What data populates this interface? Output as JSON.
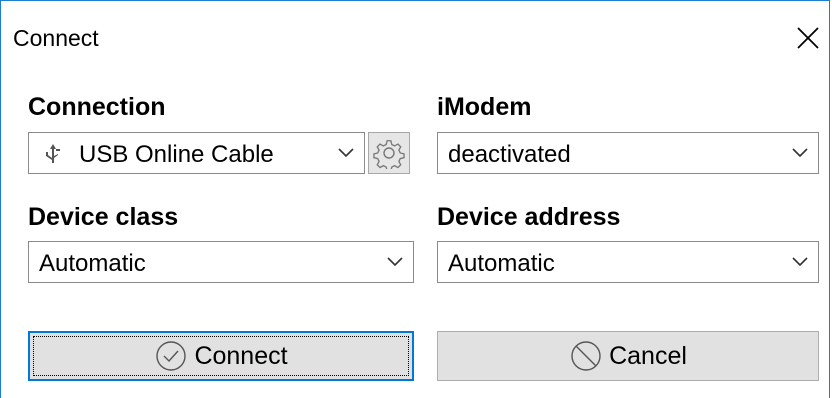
{
  "window": {
    "title": "Connect"
  },
  "connection": {
    "label": "Connection",
    "selected": "USB Online Cable"
  },
  "imodem": {
    "label": "iModem",
    "selected": "deactivated"
  },
  "device_class": {
    "label": "Device class",
    "selected": "Automatic"
  },
  "device_address": {
    "label": "Device address",
    "selected": "Automatic"
  },
  "buttons": {
    "connect_label": "Connect",
    "cancel_label": "Cancel"
  },
  "icons": {
    "close": "close-icon",
    "usb": "usb-icon",
    "settings": "gear-icon",
    "chevron": "chevron-down-icon",
    "connect": "check-circle-icon",
    "cancel": "no-entry-icon"
  },
  "colors": {
    "accent_border": "#0078d7",
    "button_face": "#e1e1e1",
    "window_border": "#1a7fd4"
  }
}
